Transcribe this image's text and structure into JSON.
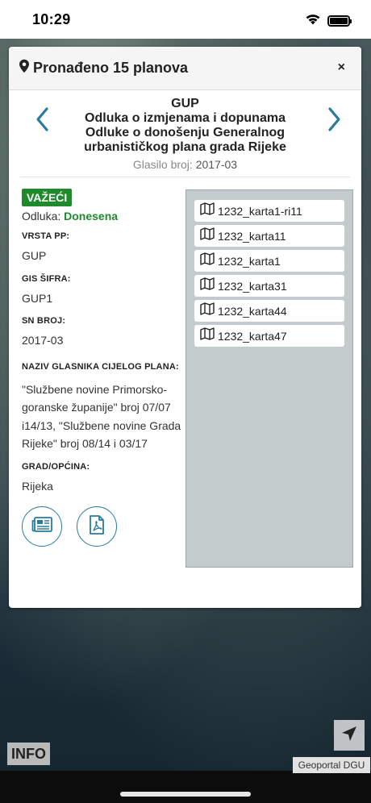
{
  "status_bar": {
    "time": "10:29"
  },
  "panel": {
    "title": "Pronađeno 15 planova",
    "close_label": "×"
  },
  "plan": {
    "type": "GUP",
    "name_lines": [
      "Odluka o izmjenama i dopunama",
      "Odluke o donošenju Generalnog",
      "urbanističkog plana grada Rijeke"
    ],
    "glasilo_label": "Glasilo broj:",
    "glasilo_value": "2017-03",
    "status_badge": "VAŽEĆI",
    "odluka_label": "Odluka:",
    "odluka_value": "Donesena",
    "fields": [
      {
        "label": "VRSTA PP:",
        "value": "GUP"
      },
      {
        "label": "GIS ŠIFRA:",
        "value": "GUP1"
      },
      {
        "label": "SN BROJ:",
        "value": "2017-03"
      },
      {
        "label": "NAZIV GLASNIKA CIJELOG PLANA:",
        "value": "\"Službene novine Primorsko-goranske županije\" broj 07/07 i14/13, \"Službene novine Grada Rijeke\" broj 08/14 i 03/17"
      },
      {
        "label": "GRAD/OPĆINA:",
        "value": "Rijeka"
      }
    ]
  },
  "maps": [
    "1232_karta1-ri11",
    "1232_karta11",
    "1232_karta1",
    "1232_karta31",
    "1232_karta44",
    "1232_karta47"
  ],
  "overlay": {
    "info_label": "INFO",
    "attribution": "Geoportal DGU"
  },
  "colors": {
    "accent": "#2a7a9c",
    "status_green": "#1f8a2c",
    "maps_panel_bg": "#c4cbcc"
  }
}
